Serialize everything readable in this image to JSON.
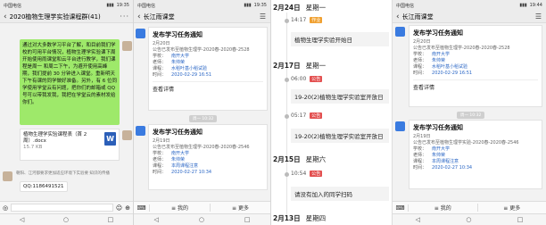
{
  "phone1": {
    "status_left": "中国电信",
    "status_right": "19:35",
    "title": "2020植物生理学实验课程群(41)",
    "message_text": "通过对大多数学习平台了解，和目前我们学校的可用平台情况，植物生理学实验课下周开始使用雨课堂和云平台进行教学，我们课程是周一 和周二下午，为避开使用高峰期，我们提前 30 分钟进入课堂。重新明天下午有课的同学做好准备。另外，有 6 位同学使用学堂云有问题，把你们的邮箱或 QQ 号可以带我发我，我把在学堂云的素材发给你们。",
    "file_name": "植物生理学实验课程表（首 2 周）.docx",
    "file_size": "15.7 KB",
    "file_icon": "W",
    "notice_text": "朝阳、江河都要求更加适应环境下实验要 知识的传播",
    "qq_text": "QQ:1186491521",
    "bottom_bar": {
      "send_label": "发送"
    },
    "accent_green": "#9ee96a"
  },
  "phone2": {
    "status_left": "中国电信",
    "status_right": "19:35",
    "title": "长江雨课堂",
    "card1": {
      "title": "发布学习任务通知",
      "date": "2月20日",
      "desc": "公告已发布至植物生理学-2020春-2020春-2528",
      "school_label": "学校：",
      "school": "南开大学",
      "teacher_label": "老师：",
      "teacher": "朱帅荣",
      "course_label": "课程：",
      "course": "水稻叶基小稻试验",
      "time_label": "时间：",
      "time": "2020-02-29 16:51",
      "more": "查看详情"
    },
    "time_sep": "周一 10:32",
    "card2": {
      "title": "发布学习任务通知",
      "date": "2月19日",
      "desc": "公告已发布至植物生理学-2020春-2020春-2546",
      "school_label": "学校：",
      "school": "南开大学",
      "teacher_label": "老师：",
      "teacher": "朱帅荣",
      "course_label": "课程：",
      "course": "本周课程注意",
      "time_label": "时间：",
      "time": "2020-02-27 10:34"
    },
    "tabs": [
      "≡ 我的",
      "≡ 更多"
    ]
  },
  "feed": {
    "groups": [
      {
        "date": "2月24日",
        "week": "星期一",
        "time": "14:17",
        "badge": "作业",
        "badge_color": "#f0a030",
        "text": "植物生理学实验开始日"
      },
      {
        "date": "2月17日",
        "week": "星期一",
        "time": "06:00",
        "badge": "公告",
        "badge_color": "#e35050",
        "text": "19-20(2)植物生理学实验室开放日"
      },
      {
        "date": "",
        "week": "",
        "time": "05:17",
        "badge": "公告",
        "badge_color": "#e35050",
        "text": "19-20(2)植物生理学实验室开放日"
      },
      {
        "date": "2月15日",
        "week": "星期六",
        "time": "10:54",
        "badge": "公告",
        "badge_color": "#e35050",
        "text": "请没有加入的同学扫码"
      },
      {
        "date": "2月13日",
        "week": "星期四",
        "time": "",
        "badge": "",
        "badge_color": "",
        "text": ""
      }
    ]
  },
  "phone3": {
    "status_left": "中国电信",
    "status_right": "19:44",
    "title": "长江雨课堂",
    "card1": {
      "title": "发布学习任务通知",
      "date": "2月20日",
      "desc": "公告已发布至植物生理学-2020春-2020春-2528",
      "school_label": "学校：",
      "school": "南开大学",
      "teacher_label": "老师：",
      "teacher": "朱帅荣",
      "course_label": "课程：",
      "course": "水稻叶基小稻试验",
      "time_label": "时间：",
      "time": "2020-02-29 16:51",
      "more": "查看详情"
    },
    "time_sep": "周一 10:32",
    "card2": {
      "title": "发布学习任务通知",
      "date": "2月19日",
      "desc": "公告已发布至植物生理学实验-2020春-2020春-2546",
      "school_label": "学校：",
      "school": "南开大学",
      "teacher_label": "老师：",
      "teacher": "朱帅荣",
      "course_label": "课程：",
      "course": "本周课程注意",
      "time_label": "时间：",
      "time": "2020-02-27 10:34"
    },
    "tabs": [
      "≡ 我的",
      "≡ 更多"
    ]
  }
}
